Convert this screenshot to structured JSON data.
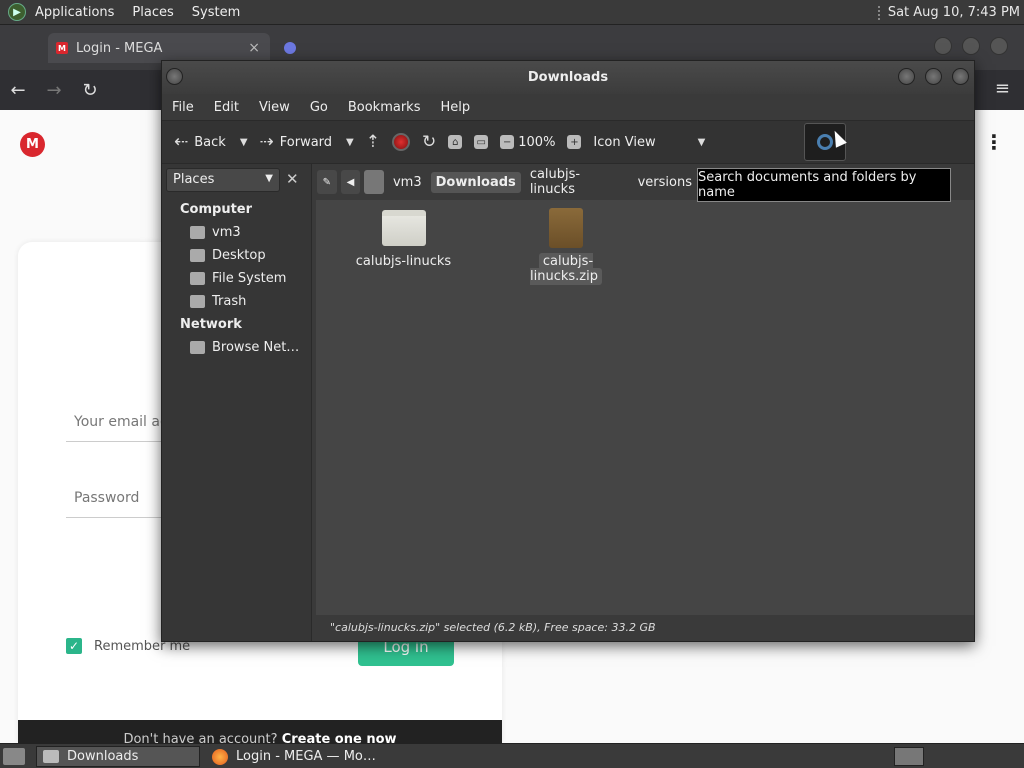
{
  "top_panel": {
    "menus": [
      "Applications",
      "Places",
      "System"
    ],
    "clock": "Sat Aug 10,  7:43 PM"
  },
  "browser": {
    "tabs": [
      {
        "title": "Login - MEGA",
        "active": true
      },
      {
        "title": "",
        "active": false
      }
    ],
    "tab_close": "×",
    "page": {
      "email_placeholder": "Your email add",
      "password_placeholder": "Password",
      "remember_label": "Remember me",
      "login_label": "Log in",
      "signup_text": "Don't have an account?",
      "signup_link": "Create one now"
    }
  },
  "file_manager": {
    "title": "Downloads",
    "menu": [
      "File",
      "Edit",
      "View",
      "Go",
      "Bookmarks",
      "Help"
    ],
    "toolbar": {
      "back": "Back",
      "forward": "Forward",
      "zoom": "100%",
      "view_mode": "Icon View"
    },
    "sidebar": {
      "selector": "Places",
      "sections": [
        {
          "heading": "Computer",
          "items": [
            "vm3",
            "Desktop",
            "File System",
            "Trash"
          ]
        },
        {
          "heading": "Network",
          "items": [
            "Browse Net…"
          ]
        }
      ]
    },
    "breadcrumbs": [
      "vm3",
      "Downloads",
      "calubjs-linucks",
      "versions"
    ],
    "current_crumb": "Downloads",
    "files": [
      {
        "name": "calubjs-linucks",
        "type": "folder",
        "selected": false
      },
      {
        "name": "calubjs-linucks.zip",
        "type": "zip",
        "selected": true
      }
    ],
    "status": "\"calubjs-linucks.zip\" selected (6.2 kB), Free space: 33.2 GB",
    "tooltip": "Search documents and folders by name"
  },
  "taskbar": {
    "items": [
      "Downloads",
      "Login - MEGA — Mo…"
    ]
  }
}
